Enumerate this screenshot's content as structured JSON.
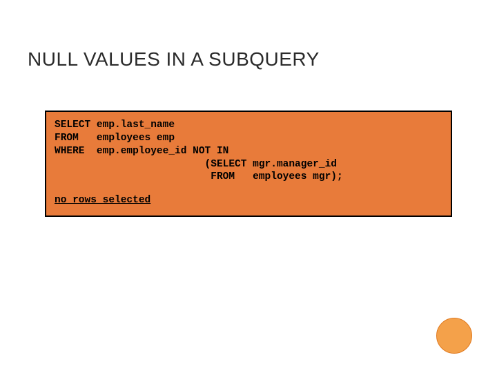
{
  "title": "NULL VALUES IN A SUBQUERY",
  "code": "SELECT emp.last_name\nFROM   employees emp\nWHERE  emp.employee_id NOT IN\n                         (SELECT mgr.manager_id\n                          FROM   employees mgr);",
  "result": "no rows selected"
}
